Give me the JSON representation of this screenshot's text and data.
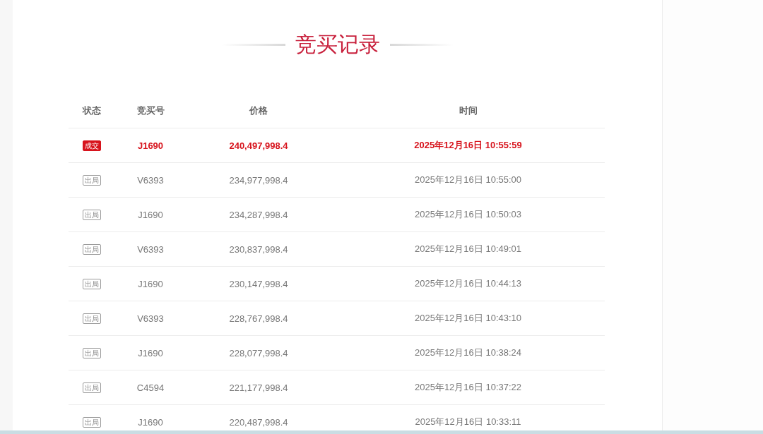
{
  "title": "竞买记录",
  "table": {
    "columns": [
      "状态",
      "竞买号",
      "价格",
      "时间"
    ],
    "rows": [
      {
        "status": "成交",
        "kind": "deal",
        "bidder": "J1690",
        "price": "240,497,998.4",
        "time": "2025年12月16日 10:55:59"
      },
      {
        "status": "出局",
        "kind": "out",
        "bidder": "V6393",
        "price": "234,977,998.4",
        "time": "2025年12月16日 10:55:00"
      },
      {
        "status": "出局",
        "kind": "out",
        "bidder": "J1690",
        "price": "234,287,998.4",
        "time": "2025年12月16日 10:50:03"
      },
      {
        "status": "出局",
        "kind": "out",
        "bidder": "V6393",
        "price": "230,837,998.4",
        "time": "2025年12月16日 10:49:01"
      },
      {
        "status": "出局",
        "kind": "out",
        "bidder": "J1690",
        "price": "230,147,998.4",
        "time": "2025年12月16日 10:44:13"
      },
      {
        "status": "出局",
        "kind": "out",
        "bidder": "V6393",
        "price": "228,767,998.4",
        "time": "2025年12月16日 10:43:10"
      },
      {
        "status": "出局",
        "kind": "out",
        "bidder": "J1690",
        "price": "228,077,998.4",
        "time": "2025年12月16日 10:38:24"
      },
      {
        "status": "出局",
        "kind": "out",
        "bidder": "C4594",
        "price": "221,177,998.4",
        "time": "2025年12月16日 10:37:22"
      },
      {
        "status": "出局",
        "kind": "out",
        "bidder": "J1690",
        "price": "220,487,998.4",
        "time": "2025年12月16日 10:33:11"
      }
    ]
  }
}
